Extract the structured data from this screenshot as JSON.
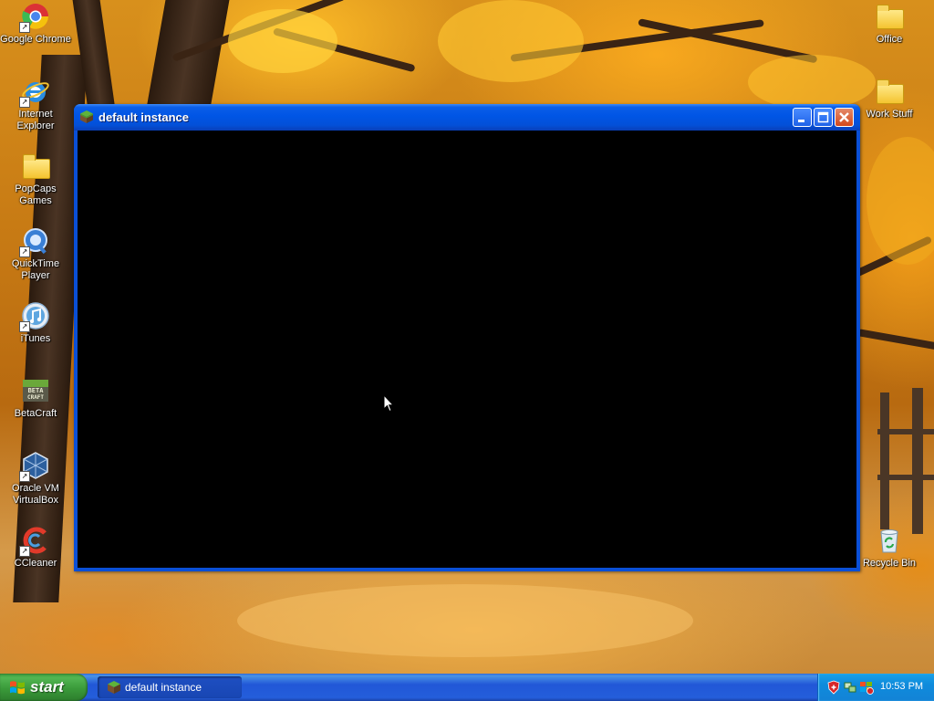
{
  "desktop": {
    "icons_left": [
      {
        "name": "google-chrome",
        "label": "Google Chrome"
      },
      {
        "name": "internet-explorer",
        "label": "Internet Explorer"
      },
      {
        "name": "popcaps-games",
        "label": "PopCaps Games"
      },
      {
        "name": "quicktime-player",
        "label": "QuickTime Player"
      },
      {
        "name": "itunes",
        "label": "iTunes"
      },
      {
        "name": "betacraft",
        "label": "BetaCraft"
      },
      {
        "name": "oracle-vm-virtualbox",
        "label": "Oracle VM VirtualBox"
      },
      {
        "name": "ccleaner",
        "label": "CCleaner"
      }
    ],
    "icons_right": [
      {
        "name": "office",
        "label": "Office"
      },
      {
        "name": "work-stuff",
        "label": "Work Stuff"
      },
      {
        "name": "recycle-bin",
        "label": "Recycle Bin"
      }
    ]
  },
  "window": {
    "title": "default instance",
    "icon": "minecraft-grass-block-icon",
    "buttons": [
      "minimize",
      "maximize",
      "close"
    ],
    "content_color": "#000000"
  },
  "taskbar": {
    "start_label": "start",
    "tasks": [
      {
        "label": "default instance",
        "icon": "minecraft-grass-block-icon"
      }
    ],
    "tray_icons": [
      "security-shield-icon",
      "network-icon",
      "windows-security-alert-icon"
    ],
    "clock": "10:53 PM"
  },
  "colors": {
    "taskbar_blue": "#245edb",
    "start_green": "#3a9a3a",
    "titlebar_blue": "#0055e5",
    "close_red": "#d2481c"
  }
}
